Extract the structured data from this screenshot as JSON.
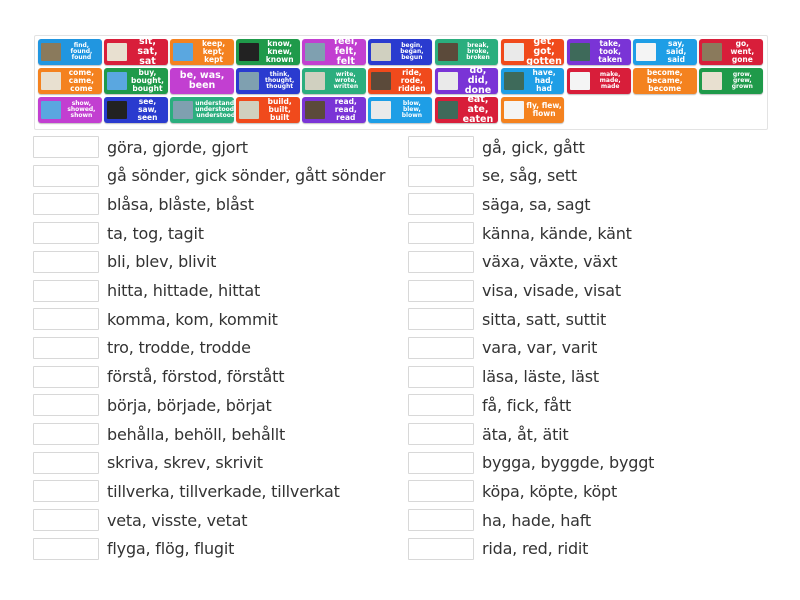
{
  "colors": {
    "blue": "#2196e0",
    "red": "#d81e3a",
    "orange": "#f4821f",
    "green": "#1f9a4a",
    "magenta": "#c23fd1",
    "navy": "#2a3bcf",
    "teal": "#2bae7e",
    "redorange": "#f04a1c",
    "purple": "#7a34d6",
    "skyblue": "#1e9ee6"
  },
  "tiles": [
    {
      "label": "find, found, found",
      "color": "#2196e0",
      "icon": "lizard-image",
      "size": "s"
    },
    {
      "label": "sit, sat, sat",
      "color": "#d81e3a",
      "icon": "sitting-person-image",
      "size": "l"
    },
    {
      "label": "keep, kept, kept",
      "color": "#f4821f",
      "icon": "sun-image",
      "size": "m"
    },
    {
      "label": "know, knew, known",
      "color": "#1f9a4a",
      "icon": "did-you-know-image",
      "size": "m"
    },
    {
      "label": "feel, felt, felt",
      "color": "#c23fd1",
      "icon": "person-arms-open-image",
      "size": "l"
    },
    {
      "label": "begin, began, begun",
      "color": "#2a3bcf",
      "icon": "begin-here-image",
      "size": "s"
    },
    {
      "label": "break, broke, broken",
      "color": "#2bae7e",
      "icon": "broken-object-image",
      "size": "s"
    },
    {
      "label": "get, got, gotten",
      "color": "#f04a1c",
      "icon": "poster-image",
      "size": "l"
    },
    {
      "label": "take, took, taken",
      "color": "#7a34d6",
      "icon": "sign-image",
      "size": "m"
    },
    {
      "label": "say, said, said",
      "color": "#1e9ee6",
      "icon": "speaking-person-image",
      "size": "m"
    },
    {
      "label": "go, went, gone",
      "color": "#d81e3a",
      "icon": "go-button-image",
      "size": "m"
    },
    {
      "label": "come, came, come",
      "color": "#f4821f",
      "icon": "person-walking-image",
      "size": "m"
    },
    {
      "label": "buy, bought, bought",
      "color": "#1f9a4a",
      "icon": "shop-image",
      "size": "m"
    },
    {
      "label": "be, was, been",
      "color": "#c23fd1",
      "icon": "",
      "size": "l"
    },
    {
      "label": "think, thought, thought",
      "color": "#2a3bcf",
      "icon": "thought-bubble-image",
      "size": "s"
    },
    {
      "label": "write, wrote, written",
      "color": "#2bae7e",
      "icon": "writing-hand-image",
      "size": "s"
    },
    {
      "label": "ride, rode, ridden",
      "color": "#f04a1c",
      "icon": "horse-rider-image",
      "size": "m"
    },
    {
      "label": "do, did, done",
      "color": "#7a34d6",
      "icon": "person-doing-image",
      "size": "l"
    },
    {
      "label": "have, had, had",
      "color": "#1e9ee6",
      "icon": "screen-image",
      "size": "m"
    },
    {
      "label": "make, made, made",
      "color": "#d81e3a",
      "icon": "making-hands-image",
      "size": "s"
    },
    {
      "label": "become, became, become",
      "color": "#f4821f",
      "icon": "",
      "size": "m"
    },
    {
      "label": "grow, grew, grown",
      "color": "#1f9a4a",
      "icon": "seedlings-image",
      "size": "s"
    },
    {
      "label": "show, showed, shown",
      "color": "#c23fd1",
      "icon": "presenter-image",
      "size": "s"
    },
    {
      "label": "see, saw, seen",
      "color": "#2a3bcf",
      "icon": "look-image",
      "size": "m"
    },
    {
      "label": "understand, understood, understood",
      "color": "#2bae7e",
      "icon": "lightbulb-head-image",
      "size": "s"
    },
    {
      "label": "build, built, built",
      "color": "#f04a1c",
      "icon": "construction-image",
      "size": "m"
    },
    {
      "label": "read, read, read",
      "color": "#7a34d6",
      "icon": "reading-child-image",
      "size": "m"
    },
    {
      "label": "blow, blew, blown",
      "color": "#1e9ee6",
      "icon": "blowing-child-image",
      "size": "s"
    },
    {
      "label": "eat, ate, eaten",
      "color": "#d81e3a",
      "icon": "eating-child-image",
      "size": "l"
    },
    {
      "label": "fly, flew, flown",
      "color": "#f4821f",
      "icon": "airplane-image",
      "size": "m"
    },
    {
      "label": "",
      "color": "",
      "icon": "",
      "size": ""
    }
  ],
  "left_items": [
    "göra, gjorde, gjort",
    "gå sönder, gick sönder, gått sönder",
    "blåsa, blåste, blåst",
    "ta, tog, tagit",
    "bli, blev, blivit",
    "hitta, hittade, hittat",
    "komma, kom, kommit",
    "tro, trodde, trodde",
    "förstå, förstod, förstått",
    "börja, började, börjat",
    "behålla, behöll, behållt",
    "skriva, skrev, skrivit",
    "tillverka, tillverkade, tillverkat",
    "veta, visste, vetat",
    "flyga, flög, flugit"
  ],
  "right_items": [
    "gå, gick, gått",
    "se, såg, sett",
    "säga, sa, sagt",
    "känna, kände, känt",
    "växa, växte, växt",
    "visa, visade, visat",
    "sitta, satt, suttit",
    "vara, var, varit",
    "läsa, läste, läst",
    "få, fick, fått",
    "äta, åt, ätit",
    "bygga, byggde, byggt",
    "köpa, köpte, köpt",
    "ha, hade, haft",
    "rida, red, ridit"
  ]
}
